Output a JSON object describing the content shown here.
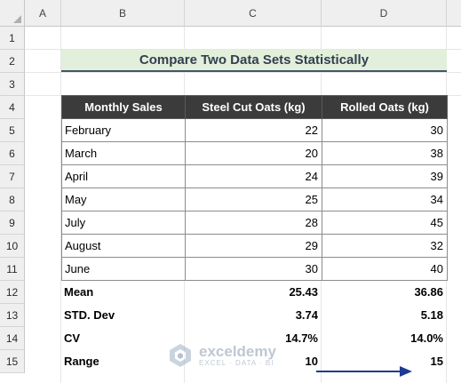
{
  "sheet": {
    "columns": [
      "A",
      "B",
      "C",
      "D"
    ],
    "rows": [
      "1",
      "2",
      "3",
      "4",
      "5",
      "6",
      "7",
      "8",
      "9",
      "10",
      "11",
      "12",
      "13",
      "14",
      "15"
    ]
  },
  "title": "Compare Two Data Sets Statistically",
  "table": {
    "headers": [
      "Monthly Sales",
      "Steel Cut Oats (kg)",
      "Rolled Oats (kg)"
    ],
    "rows": [
      [
        "February",
        "22",
        "30"
      ],
      [
        "March",
        "20",
        "38"
      ],
      [
        "April",
        "24",
        "39"
      ],
      [
        "May",
        "25",
        "34"
      ],
      [
        "July",
        "28",
        "45"
      ],
      [
        "August",
        "29",
        "32"
      ],
      [
        "June",
        "30",
        "40"
      ]
    ]
  },
  "stats": [
    [
      "Mean",
      "25.43",
      "36.86"
    ],
    [
      "STD. Dev",
      "3.74",
      "5.18"
    ],
    [
      "CV",
      "14.7%",
      "14.0%"
    ],
    [
      "Range",
      "10",
      "15"
    ]
  ],
  "watermark": {
    "name": "exceldemy",
    "tagline": "EXCEL · DATA · BI",
    "icon": "exceldemy-logo-icon"
  },
  "colors": {
    "header_bg": "#3b3b3b",
    "title_bg": "#e2efda",
    "title_text": "#333f4f",
    "arrow": "#1f3a93"
  }
}
